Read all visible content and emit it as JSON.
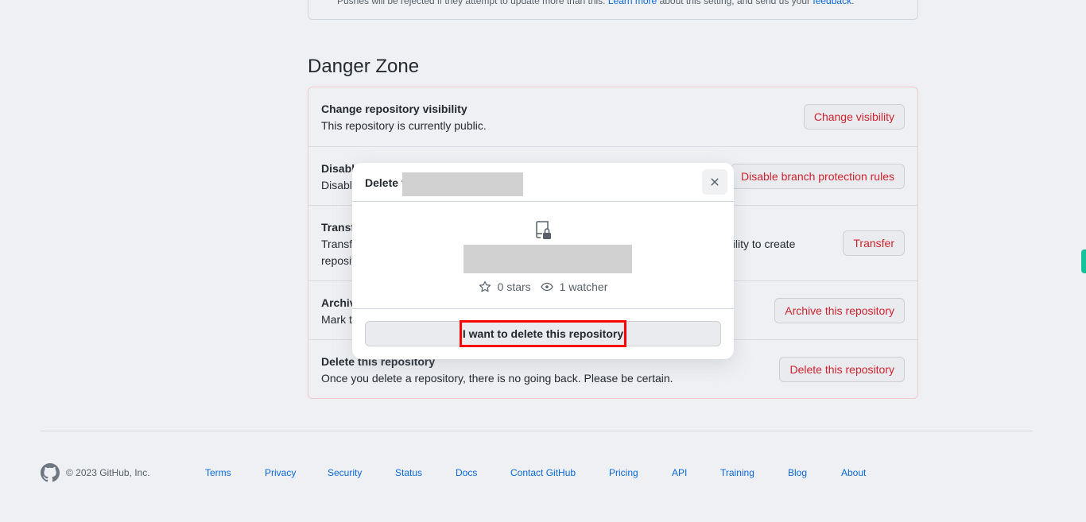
{
  "top_notice": {
    "text_before": "Pushes will be rejected if they attempt to update more than this. ",
    "learn_more_link": "Learn more",
    "text_middle": " about this setting, and send us your ",
    "feedback_link": "feedback",
    "text_after": "."
  },
  "danger_zone": {
    "title": "Danger Zone",
    "rows": [
      {
        "title": "Change repository visibility",
        "description": "This repository is currently public.",
        "button": "Change visibility"
      },
      {
        "title": "Disable branch protection rules",
        "description": "Disable branch protection rules enforcement and APIs",
        "button": "Disable branch protection rules"
      },
      {
        "title": "Transfer ownership",
        "description": "Transfer this repository to another user or to an organization where you have the ability to create repositories.",
        "description_visible_fragment": "lity to create",
        "button": "Transfer"
      },
      {
        "title": "Archive this repository",
        "description": "Mark this repository as archived and read-only.",
        "button": "Archive this repository"
      },
      {
        "title": "Delete this repository",
        "description": "Once you delete a repository, there is no going back. Please be certain.",
        "button": "Delete this repository"
      }
    ]
  },
  "modal": {
    "title_prefix": "Delete t",
    "repo_icon": "repo-locked-icon",
    "stars": "0 stars",
    "watchers": "1 watcher",
    "confirm_button": "I want to delete this repository",
    "close_icon": "close-icon"
  },
  "footer": {
    "copyright": "© 2023 GitHub, Inc.",
    "links": [
      "Terms",
      "Privacy",
      "Security",
      "Status",
      "Docs",
      "Contact GitHub",
      "Pricing",
      "API",
      "Training",
      "Blog",
      "About"
    ]
  },
  "colors": {
    "danger": "#cf222e",
    "link": "#0969da",
    "highlight": "#ff0000",
    "side_tab": "#14c39b"
  }
}
